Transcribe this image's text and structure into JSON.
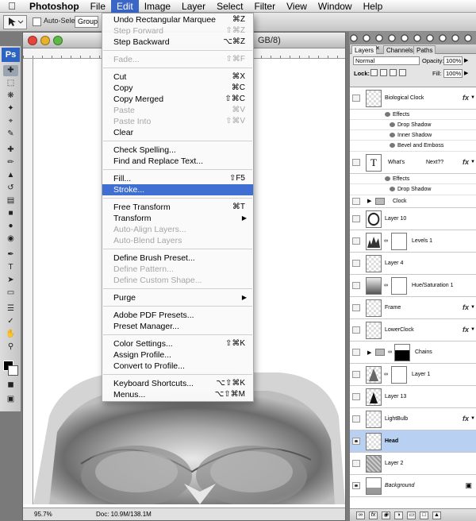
{
  "menubar": {
    "items": [
      {
        "label": "Photoshop"
      },
      {
        "label": "File"
      },
      {
        "label": "Edit"
      },
      {
        "label": "Image"
      },
      {
        "label": "Layer"
      },
      {
        "label": "Select"
      },
      {
        "label": "Filter"
      },
      {
        "label": "View"
      },
      {
        "label": "Window"
      },
      {
        "label": "Help"
      }
    ]
  },
  "options": {
    "auto_select_label": "Auto-Select:",
    "auto_select_value": "Group"
  },
  "toolbox": {
    "logo": "Ps"
  },
  "document": {
    "title_suffix": "GB/8)",
    "zoom": "95.7%",
    "doc_info": "Doc: 10.9M/138.1M"
  },
  "edit_menu": {
    "items": [
      {
        "label": "Undo Rectangular Marquee",
        "shortcut": "⌘Z",
        "disabled": false
      },
      {
        "label": "Step Forward",
        "shortcut": "⇧⌘Z",
        "disabled": true
      },
      {
        "label": "Step Backward",
        "shortcut": "⌥⌘Z",
        "disabled": false
      },
      {
        "label": "Fade...",
        "shortcut": "⇧⌘F",
        "disabled": true
      },
      {
        "label": "Cut",
        "shortcut": "⌘X",
        "disabled": false
      },
      {
        "label": "Copy",
        "shortcut": "⌘C",
        "disabled": false
      },
      {
        "label": "Copy Merged",
        "shortcut": "⇧⌘C",
        "disabled": false
      },
      {
        "label": "Paste",
        "shortcut": "⌘V",
        "disabled": true
      },
      {
        "label": "Paste Into",
        "shortcut": "⇧⌘V",
        "disabled": true
      },
      {
        "label": "Clear",
        "shortcut": "",
        "disabled": false
      },
      {
        "label": "Check Spelling...",
        "shortcut": "",
        "disabled": false
      },
      {
        "label": "Find and Replace Text...",
        "shortcut": "",
        "disabled": false
      },
      {
        "label": "Fill...",
        "shortcut": "⇧F5",
        "disabled": false
      },
      {
        "label": "Stroke...",
        "shortcut": "",
        "disabled": false
      },
      {
        "label": "Free Transform",
        "shortcut": "⌘T",
        "disabled": false
      },
      {
        "label": "Transform",
        "shortcut": "",
        "disabled": false
      },
      {
        "label": "Auto-Align Layers...",
        "shortcut": "",
        "disabled": true
      },
      {
        "label": "Auto-Blend Layers",
        "shortcut": "",
        "disabled": true
      },
      {
        "label": "Define Brush Preset...",
        "shortcut": "",
        "disabled": false
      },
      {
        "label": "Define Pattern...",
        "shortcut": "",
        "disabled": true
      },
      {
        "label": "Define Custom Shape...",
        "shortcut": "",
        "disabled": true
      },
      {
        "label": "Purge",
        "shortcut": "",
        "disabled": false
      },
      {
        "label": "Adobe PDF Presets...",
        "shortcut": "",
        "disabled": false
      },
      {
        "label": "Preset Manager...",
        "shortcut": "",
        "disabled": false
      },
      {
        "label": "Color Settings...",
        "shortcut": "⇧⌘K",
        "disabled": false
      },
      {
        "label": "Assign Profile...",
        "shortcut": "",
        "disabled": false
      },
      {
        "label": "Convert to Profile...",
        "shortcut": "",
        "disabled": false
      },
      {
        "label": "Keyboard Shortcuts...",
        "shortcut": "⌥⇧⌘K",
        "disabled": false
      },
      {
        "label": "Menus...",
        "shortcut": "⌥⇧⌘M",
        "disabled": false
      }
    ]
  },
  "layers_panel": {
    "tabs": [
      "Layers",
      "Channels",
      "Paths"
    ],
    "blend_mode": "Normal",
    "opacity_label": "Opacity:",
    "opacity_value": "100%",
    "lock_label": "Lock:",
    "fill_label": "Fill:",
    "fill_value": "100%",
    "layers": [
      {
        "name": "Biological Clock",
        "fx": "fx"
      },
      {
        "name": "Effects"
      },
      {
        "name": "Drop Shadow"
      },
      {
        "name": "Inner Shadow"
      },
      {
        "name": "Bevel and Emboss"
      },
      {
        "name": "What's",
        "name2": "Next??",
        "fx": "fx",
        "thumb": "T"
      },
      {
        "name": "Effects"
      },
      {
        "name": "Drop Shadow"
      },
      {
        "name": "Clock"
      },
      {
        "name": "Layer 10"
      },
      {
        "name": "Levels 1"
      },
      {
        "name": "Layer 4"
      },
      {
        "name": "Hue/Saturation 1"
      },
      {
        "name": "Frame",
        "fx": "fx"
      },
      {
        "name": "LowerClock",
        "fx": "fx"
      },
      {
        "name": "Chains"
      },
      {
        "name": "Layer 1"
      },
      {
        "name": "Layer 13"
      },
      {
        "name": "LightBulb",
        "fx": "fx"
      },
      {
        "name": "Head"
      },
      {
        "name": "Layer 2"
      },
      {
        "name": "Background"
      }
    ]
  },
  "colors": {
    "accent": "#3f6fd1",
    "selected_layer": "#b8d1f2"
  }
}
